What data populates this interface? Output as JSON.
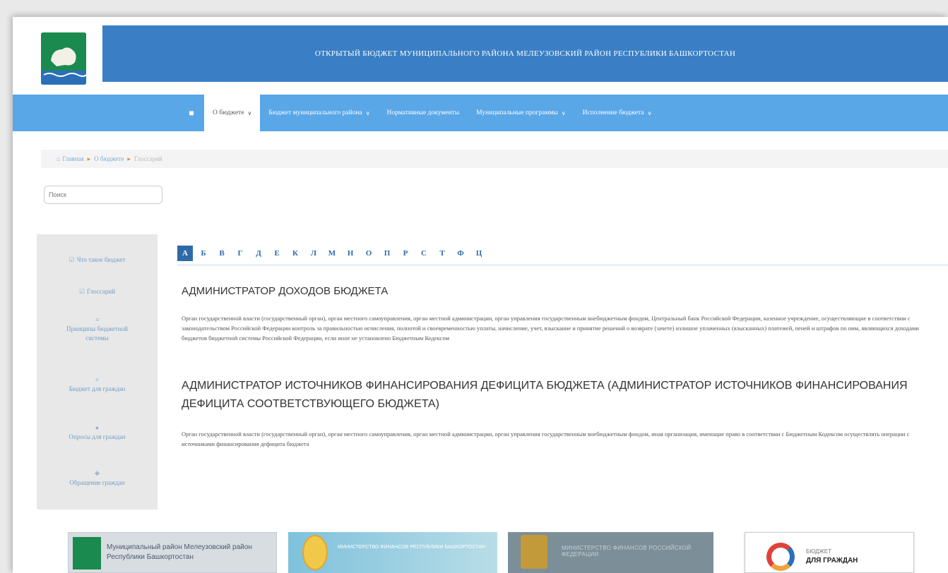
{
  "header": {
    "title": "ОТКРЫТЫЙ БЮДЖЕТ МУНИЦИПАЛЬНОГО РАЙОНА МЕЛЕУЗОВСКИЙ РАЙОН РЕСПУБЛИКИ БАШКОРТОСТАН"
  },
  "nav": {
    "home_icon": "home-icon",
    "items": [
      {
        "label": "О бюджете",
        "has_dropdown": true,
        "active": true
      },
      {
        "label": "Бюджет муниципального района",
        "has_dropdown": true
      },
      {
        "label": "Нормативные документы",
        "has_dropdown": false
      },
      {
        "label": "Муниципальные программы",
        "has_dropdown": true
      },
      {
        "label": "Исполнение бюджета",
        "has_dropdown": true
      }
    ]
  },
  "breadcrumb": {
    "home": "Главная",
    "section": "О бюджете",
    "current": "Глоссарий"
  },
  "search": {
    "placeholder": "Поиск"
  },
  "sidebar": {
    "items": [
      {
        "label": "Что такое бюджет",
        "icon": "check-icon"
      },
      {
        "label": "Глоссарий",
        "icon": "check-icon"
      },
      {
        "label": "Принципы бюджетной системы",
        "icon": "list-icon"
      },
      {
        "label": "Бюджет для граждан",
        "icon": "document-icon"
      },
      {
        "label": "Опросы для граждан",
        "icon": "poll-icon"
      },
      {
        "label": "Обращение граждан",
        "icon": "user-icon"
      }
    ]
  },
  "alphabet": {
    "letters": [
      "А",
      "Б",
      "В",
      "Г",
      "Д",
      "Е",
      "К",
      "Л",
      "М",
      "Н",
      "О",
      "П",
      "Р",
      "С",
      "Т",
      "Ф",
      "Ц"
    ],
    "active": "А"
  },
  "terms": [
    {
      "title": "АДМИНИСТРАТОР ДОХОДОВ БЮДЖЕТА",
      "text": "Орган государственной власти (государственный орган), орган местного самоуправления, орган местной администрации, орган управления государственным внебюджетным фондом, Центральный банк Российской Федерации, казенное учреждение, осуществляющие в соответствии с законодательством Российской Федерации контроль за правильностью исчисления, полнотой и своевременностью уплаты, начисление, учет, взыскание и принятие решений о возврате (зачете) излишне уплаченных (взысканных) платежей, пеней и штрафов по ним, являющихся доходами бюджетов бюджетной системы Российской Федерации, если иное не установлено Бюджетным Кодексом"
    },
    {
      "title": "АДМИНИСТРАТОР ИСТОЧНИКОВ ФИНАНСИРОВАНИЯ ДЕФИЦИТА БЮДЖЕТА (АДМИНИСТРАТОР ИСТОЧНИКОВ ФИНАНСИРОВАНИЯ ДЕФИЦИТА СООТВЕТСТВУЮЩЕГО БЮДЖЕТА)",
      "text": "Орган государственной власти (государственный орган), орган местного самоуправления, орган местной администрации, орган управления государственным внебюджетным фондом, иная организация, имеющие право в соответствии с Бюджетным Кодексом осуществлять операции с источниками финансирования дефицита бюджета"
    }
  ],
  "banners": [
    {
      "text": "Муниципальный район Мелеузовский район Республики Башкортостан"
    },
    {
      "text": "МИНИСТЕРСТВО ФИНАНСОВ РЕСПУБЛИКИ БАШКОРТОСТАН"
    },
    {
      "text": "МИНИСТЕРСТВО ФИНАНСОВ РОССИЙСКОЙ ФЕДЕРАЦИИ"
    },
    {
      "line1": "БЮДЖЕТ",
      "line2": "ДЛЯ ГРАЖДАН"
    }
  ],
  "colors": {
    "title_band": "#3a7fc5",
    "navbar": "#5aa7e8",
    "accent": "#2f6aa8"
  }
}
